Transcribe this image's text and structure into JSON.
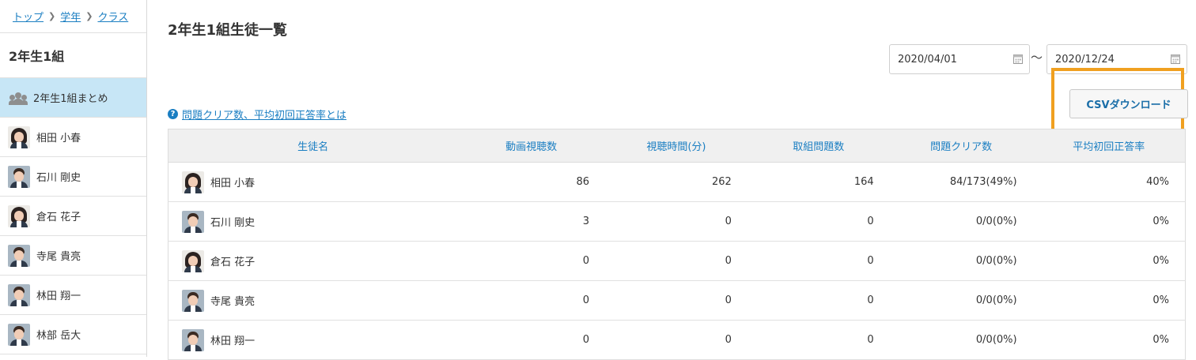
{
  "breadcrumb": [
    {
      "label": "トップ"
    },
    {
      "label": "学年"
    },
    {
      "label": "クラス"
    }
  ],
  "sidebar": {
    "class_title": "2年生1組",
    "summary_label": "2年生1組まとめ",
    "students": [
      {
        "name": "相田 小春"
      },
      {
        "name": "石川 剛史"
      },
      {
        "name": "倉石 花子"
      },
      {
        "name": "寺尾 貴亮"
      },
      {
        "name": "林田 翔一"
      },
      {
        "name": "林部 岳大"
      }
    ]
  },
  "main": {
    "title": "2年生1組生徒一覧",
    "date_from": "2020/04/01",
    "date_to": "2020/12/24",
    "range_separator": "〜",
    "csv_button": "CSVダウンロード",
    "help_link": "問題クリア数、平均初回正答率とは",
    "help_icon": "?",
    "table": {
      "headers": [
        "生徒名",
        "動画視聴数",
        "視聴時間(分)",
        "取組問題数",
        "問題クリア数",
        "平均初回正答率"
      ],
      "rows": [
        {
          "name": "相田 小春",
          "videos": "86",
          "minutes": "262",
          "attempted": "164",
          "cleared": "84/173(49%)",
          "accuracy": "40%"
        },
        {
          "name": "石川 剛史",
          "videos": "3",
          "minutes": "0",
          "attempted": "0",
          "cleared": "0/0(0%)",
          "accuracy": "0%"
        },
        {
          "name": "倉石 花子",
          "videos": "0",
          "minutes": "0",
          "attempted": "0",
          "cleared": "0/0(0%)",
          "accuracy": "0%"
        },
        {
          "name": "寺尾 貴亮",
          "videos": "0",
          "minutes": "0",
          "attempted": "0",
          "cleared": "0/0(0%)",
          "accuracy": "0%"
        },
        {
          "name": "林田 翔一",
          "videos": "0",
          "minutes": "0",
          "attempted": "0",
          "cleared": "0/0(0%)",
          "accuracy": "0%"
        }
      ]
    }
  },
  "icons": {
    "group": "group-icon",
    "calendar": "calendar-icon",
    "help": "help-circle-icon",
    "chevron": "chevron-right-icon"
  },
  "colors": {
    "link": "#1a7ec2",
    "active_bg": "#c7e6f6",
    "highlight": "#f0a020",
    "header_bg": "#f0f0f0"
  }
}
